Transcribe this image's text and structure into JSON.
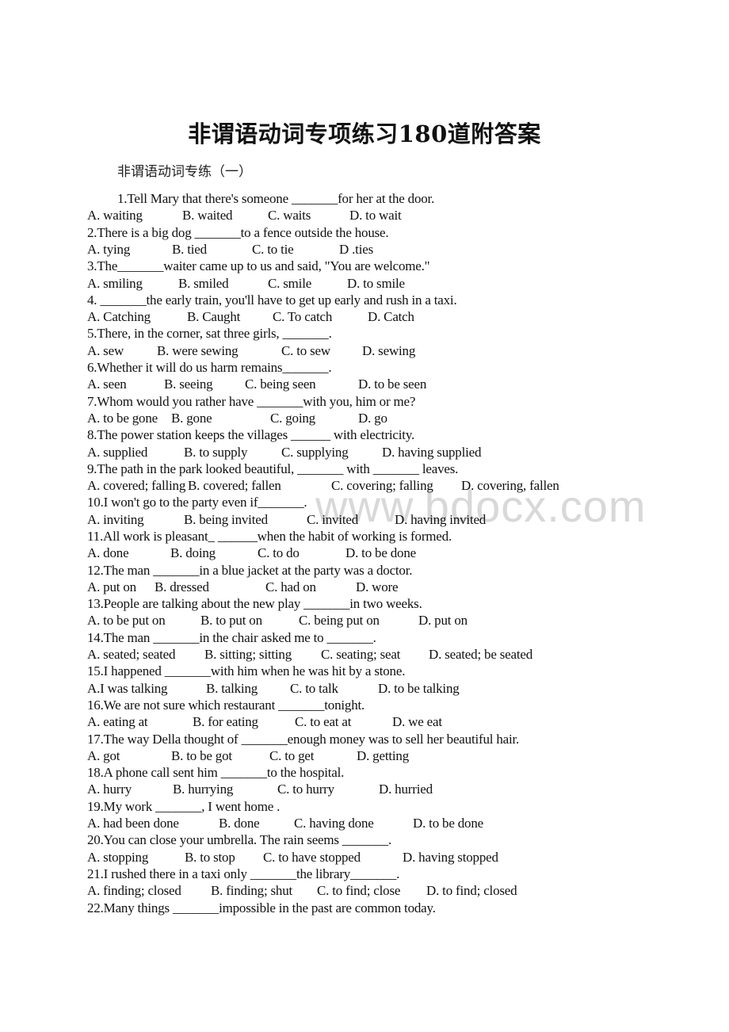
{
  "document": {
    "title": "非谓语动词专项练习180道附答案",
    "section_heading": "非谓语动词专练（一）",
    "watermark": "www.bdocx.com",
    "questions": [
      {
        "q": "1.Tell Mary that there's someone _______for her at the door.",
        "options": [
          "A. waiting",
          "B. waited",
          "C. waits",
          "D. to wait"
        ]
      },
      {
        "q": "2.There is a big dog _______to a fence outside the house.",
        "options": [
          "A. tying",
          "B. tied",
          "C. to tie",
          "D .ties"
        ]
      },
      {
        "q": "3.The_______waiter came up to us and said, \"You are welcome.\"",
        "options": [
          "A. smiling",
          "B. smiled",
          "C. smile",
          "D. to smile"
        ]
      },
      {
        "q": "4. _______the early train, you'll have to get up early and rush in a taxi.",
        "options": [
          "A. Catching",
          "B. Caught",
          "C. To catch",
          "D. Catch"
        ]
      },
      {
        "q": "5.There, in the corner, sat three girls, _______.",
        "options": [
          "A. sew",
          "B. were sewing",
          "C. to sew",
          "D. sewing"
        ]
      },
      {
        "q": "6.Whether it will do us harm remains_______.",
        "options": [
          "A. seen",
          "B. seeing",
          "C. being seen",
          "D. to be seen"
        ]
      },
      {
        "q": "7.Whom would you rather have _______with you, him or me?",
        "options": [
          "A. to be gone",
          "B. gone",
          "C. going",
          "D. go"
        ]
      },
      {
        "q": "8.The power station keeps the villages ______ with electricity.",
        "options": [
          "A. supplied",
          "B. to supply",
          "C. supplying",
          "D. having supplied"
        ]
      },
      {
        "q": "9.The path in the park looked beautiful, _______ with _______ leaves.",
        "options": [
          "A. covered; falling",
          "B. covered; fallen",
          "C. covering; falling",
          "D. covering, fallen"
        ]
      },
      {
        "q": "10.I won't go to the party even if_______.",
        "options": [
          "A. inviting",
          "B. being invited",
          "C. invited",
          "D. having invited"
        ]
      },
      {
        "q": "11.All work is pleasant_ ______when the habit of working is formed.",
        "options": [
          "A. done",
          "B. doing",
          "C. to do",
          "D. to be done"
        ]
      },
      {
        "q": "12.The man _______in a blue jacket at the party was a doctor.",
        "options": [
          "A. put on",
          "B. dressed",
          "C. had on",
          "D. wore"
        ]
      },
      {
        "q": "13.People are talking about the new play _______in two weeks.",
        "options": [
          "A. to be put on",
          "B. to put on",
          "C. being put on",
          "D. put on"
        ]
      },
      {
        "q": "14.The man _______in the chair asked me to _______.",
        "options": [
          "A. seated; seated",
          "B. sitting; sitting",
          "C. seating; seat",
          "D. seated; be seated"
        ]
      },
      {
        "q": "15.I happened _______with him when he was hit by a stone.",
        "options": [
          "A.I was talking",
          "B. talking",
          "C. to talk",
          "D. to be talking"
        ]
      },
      {
        "q": "16.We are not sure which restaurant _______tonight.",
        "options": [
          "A. eating at",
          "B. for eating",
          "C. to eat at",
          "D. we eat"
        ]
      },
      {
        "q": "17.The way Della thought of _______enough money was to sell her beautiful hair.",
        "options": [
          "A. got",
          "B. to be got",
          "C. to get",
          "D. getting"
        ]
      },
      {
        "q": "18.A phone call sent him _______to the hospital.",
        "options": [
          "A. hurry",
          "B. hurrying",
          "C. to hurry",
          "D. hurried"
        ]
      },
      {
        "q": "19.My work _______, I went home .",
        "options": [
          "A. had been done",
          "B. done",
          "C. having done",
          "D. to be done"
        ]
      },
      {
        "q": "20.You can close your umbrella. The rain seems _______.",
        "options": [
          "A. stopping",
          "B. to stop",
          "C. to have stopped",
          "D. having stopped"
        ]
      },
      {
        "q": "21.I rushed there in a taxi only _______the library_______.",
        "options": [
          "A. finding; closed",
          "B. finding; shut",
          "C. to find; close",
          "D. to find; closed"
        ]
      },
      {
        "q": "22.Many things _______impossible in the past are common today.",
        "options": []
      }
    ]
  }
}
